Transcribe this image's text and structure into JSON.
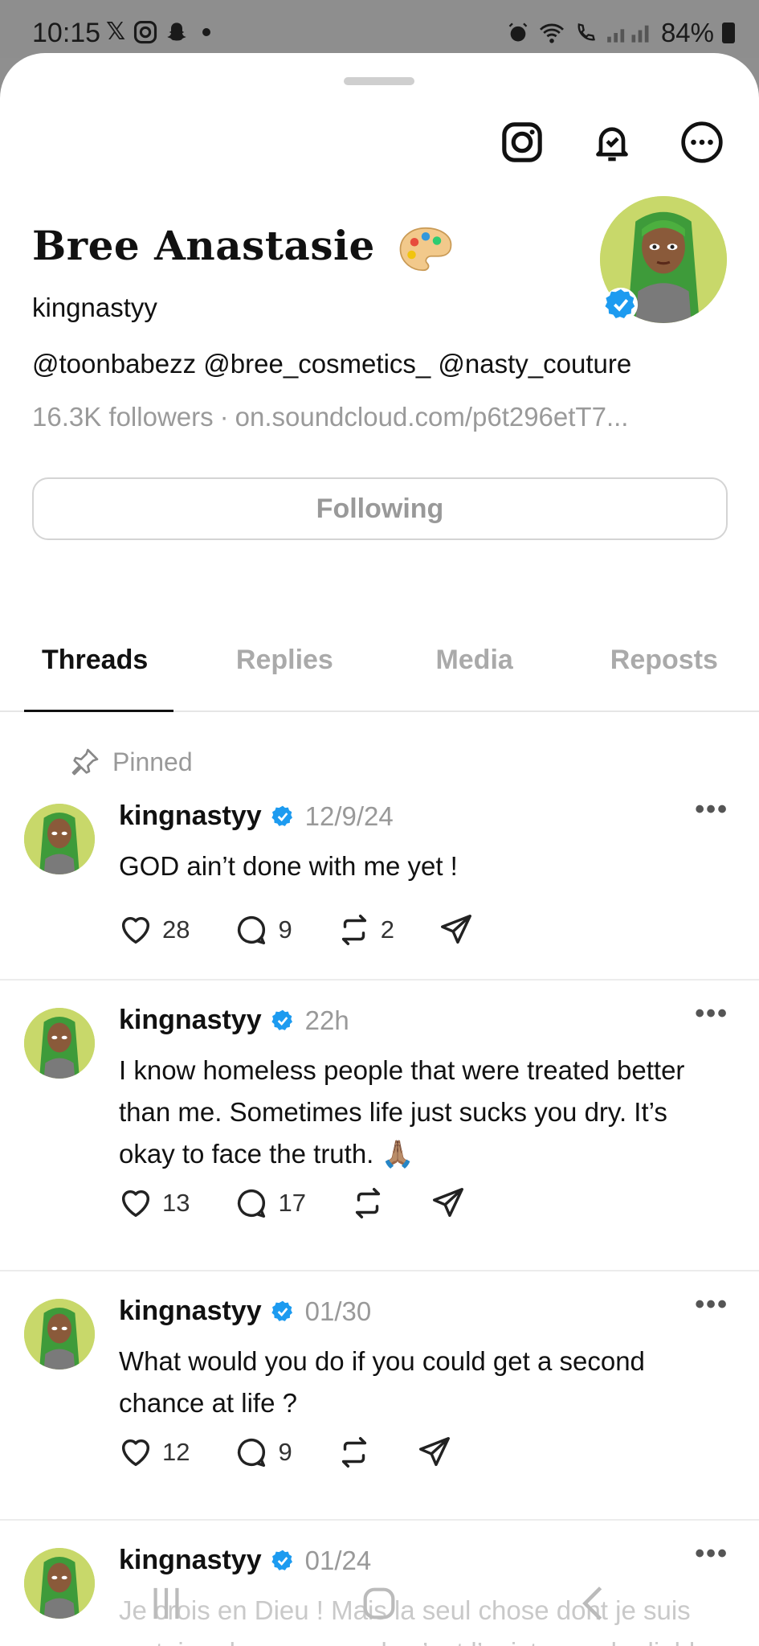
{
  "status_bar": {
    "time": "10:15",
    "left_icons": [
      "x-icon",
      "instagram-icon",
      "snapchat-icon"
    ],
    "battery": "84%"
  },
  "profile": {
    "display_name": "Bree Anastasie",
    "username": "kingnastyy",
    "bio": "@toonbabezz @bree_cosmetics_ @nasty_couture",
    "followers": "16.3K followers",
    "link": "on.soundcloud.com/p6t296etT7...",
    "follow_button": "Following"
  },
  "tabs": [
    "Threads",
    "Replies",
    "Media",
    "Reposts"
  ],
  "pinned_label": "Pinned",
  "posts": [
    {
      "user": "kingnastyy",
      "time": "12/9/24",
      "text": "GOD ain’t done with me yet !",
      "likes": "28",
      "replies": "9",
      "reposts": "2"
    },
    {
      "user": "kingnastyy",
      "time": "22h",
      "text": "I know homeless people that were treated better than me. Sometimes life just sucks you dry. It’s okay to face the truth. 🙏🏽",
      "likes": "13",
      "replies": "17",
      "reposts": ""
    },
    {
      "user": "kingnastyy",
      "time": "01/30",
      "text": "What would you do if you could get a second chance at life ?",
      "likes": "12",
      "replies": "9",
      "reposts": ""
    },
    {
      "user": "kingnastyy",
      "time": "01/24",
      "text": "Je crois en Dieu ! Mais la seul chose dont je suis certaine dans ce monde c’est l’existence du diable. L’existence du mal. Par la manière",
      "likes": "",
      "replies": "",
      "reposts": ""
    }
  ],
  "colors": {
    "verified": "#1d9bf0",
    "avatar_bg": "#c8d86a"
  }
}
